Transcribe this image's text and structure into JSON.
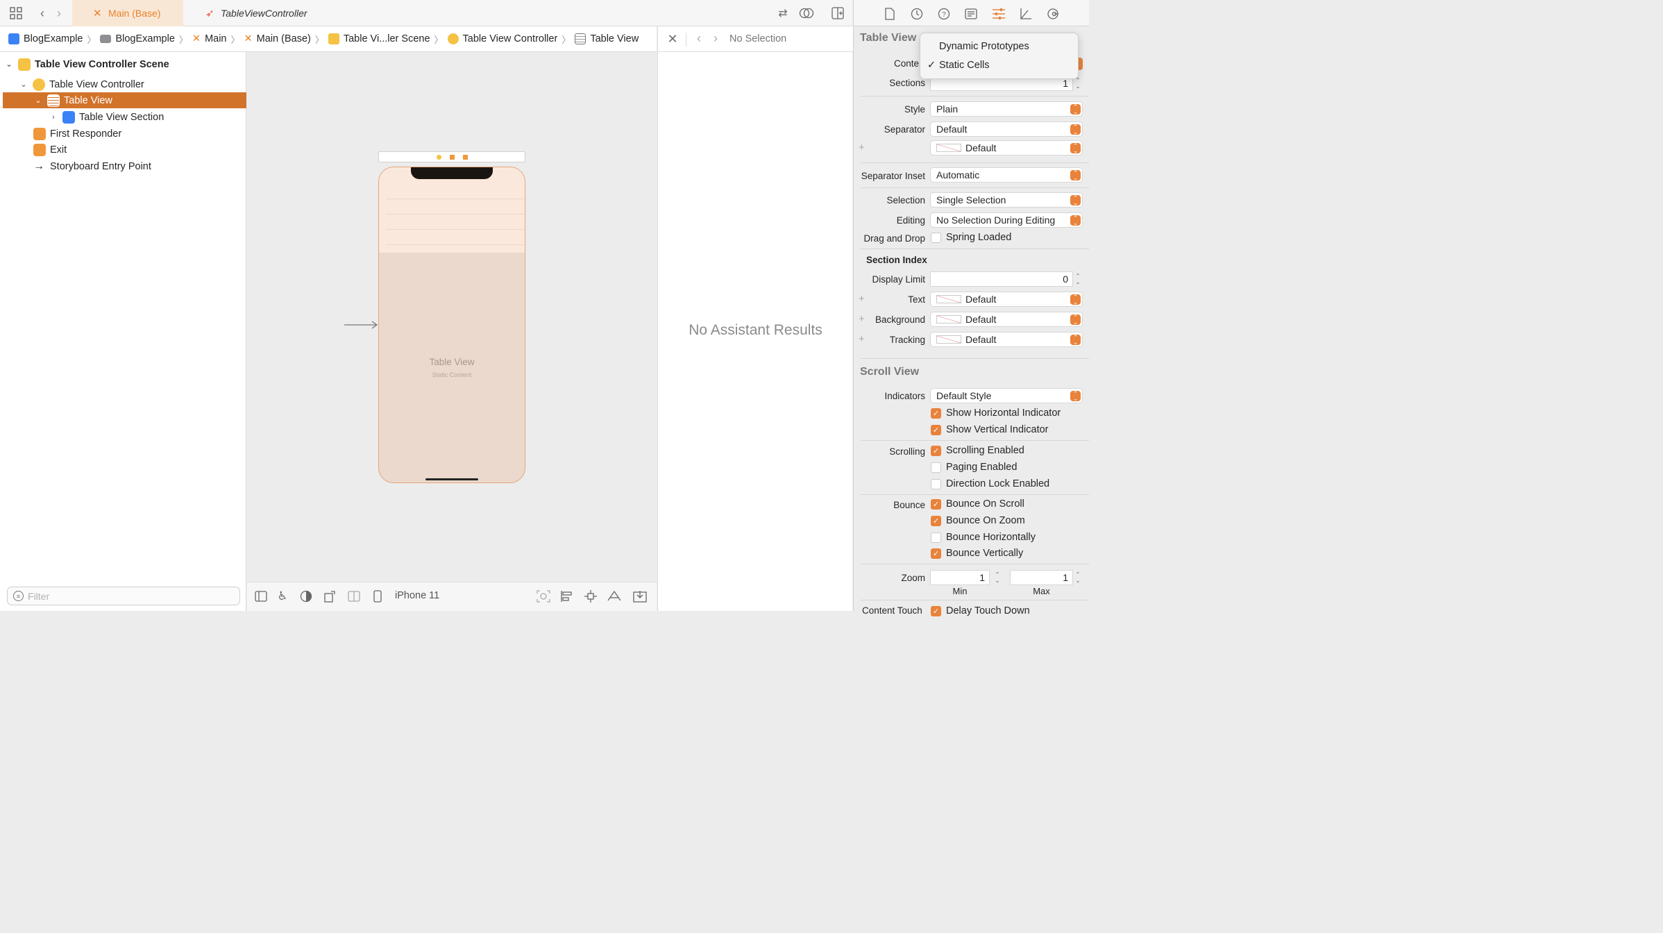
{
  "tabs": [
    {
      "label": "Main (Base)"
    },
    {
      "label": "TableViewController"
    }
  ],
  "breadcrumb": [
    "BlogExample",
    "BlogExample",
    "Main",
    "Main (Base)",
    "Table Vi...ler Scene",
    "Table View Controller",
    "Table View"
  ],
  "navigator": {
    "scene": "Table View Controller Scene",
    "controller": "Table View Controller",
    "table_view": "Table View",
    "section": "Table View Section",
    "first_responder": "First Responder",
    "exit": "Exit",
    "entry_point": "Storyboard Entry Point",
    "filter_placeholder": "Filter"
  },
  "canvas": {
    "table_view_label": "Table View",
    "static_content": "Static Content",
    "device": "iPhone 11"
  },
  "assistant": {
    "no_selection": "No Selection",
    "no_results": "No Assistant Results"
  },
  "inspector": {
    "section_title": "Table View",
    "content_label": "Conte",
    "dropdown": {
      "option1": "Dynamic Prototypes",
      "option2": "Static Cells",
      "checkmark": "✓"
    },
    "sections_label": "Sections",
    "sections_value": "1",
    "style_label": "Style",
    "style_value": "Plain",
    "separator_label": "Separator",
    "separator_value": "Default",
    "separator_color": "Default",
    "separator_inset_label": "Separator Inset",
    "separator_inset_value": "Automatic",
    "selection_label": "Selection",
    "selection_value": "Single Selection",
    "editing_label": "Editing",
    "editing_value": "No Selection During Editing",
    "dnd_label": "Drag and Drop",
    "spring_loaded": "Spring Loaded",
    "section_index": "Section Index",
    "display_limit_label": "Display Limit",
    "display_limit_value": "0",
    "text_label": "Text",
    "text_value": "Default",
    "background_label": "Background",
    "background_value": "Default",
    "tracking_label": "Tracking",
    "tracking_value": "Default",
    "scroll_view_title": "Scroll View",
    "indicators_label": "Indicators",
    "indicators_value": "Default Style",
    "show_horizontal": "Show Horizontal Indicator",
    "show_vertical": "Show Vertical Indicator",
    "scrolling_label": "Scrolling",
    "scrolling_enabled": "Scrolling Enabled",
    "paging_enabled": "Paging Enabled",
    "direction_lock": "Direction Lock Enabled",
    "bounce_label": "Bounce",
    "bounce_on_scroll": "Bounce On Scroll",
    "bounce_on_zoom": "Bounce On Zoom",
    "bounce_horizontally": "Bounce Horizontally",
    "bounce_vertically": "Bounce Vertically",
    "zoom_label": "Zoom",
    "zoom_min_value": "1",
    "zoom_max_value": "1",
    "min_label": "Min",
    "max_label": "Max",
    "content_touch_label": "Content Touch",
    "delay_touch_down": "Delay Touch Down"
  },
  "colors": {
    "accent": "#e9823a",
    "selection": "#d2732a"
  }
}
